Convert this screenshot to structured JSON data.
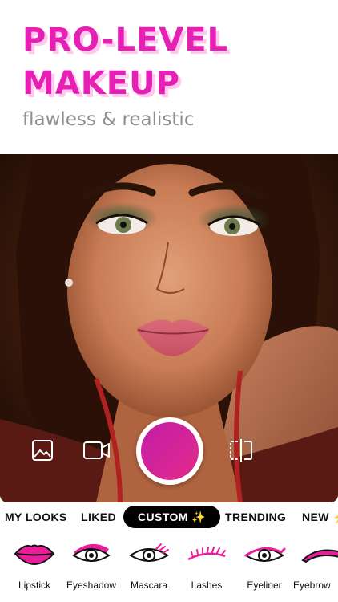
{
  "header": {
    "headline_line1": "PRO-LEVEL",
    "headline_line2": "MAKEUP",
    "tagline": "flawless & realistic"
  },
  "camera": {
    "gallery_icon": "image-icon",
    "video_icon": "video-camera-icon",
    "compare_icon": "split-compare-icon",
    "shutter_color": "#d4239c"
  },
  "tabs": [
    {
      "label": "MY LOOKS"
    },
    {
      "label": "LIKED"
    },
    {
      "label": "CUSTOM ✨"
    },
    {
      "label": "TRENDING"
    },
    {
      "label": "NEW ⚡"
    }
  ],
  "active_tab": "CUSTOM ✨",
  "tools": [
    {
      "label": "Lipstick",
      "icon": "lips-icon"
    },
    {
      "label": "Eyeshadow",
      "icon": "eyeshadow-icon"
    },
    {
      "label": "Mascara",
      "icon": "mascara-eye-icon"
    },
    {
      "label": "Lashes",
      "icon": "lashes-icon"
    },
    {
      "label": "Eyeliner",
      "icon": "eyeliner-icon"
    },
    {
      "label": "Eyebrow",
      "icon": "eyebrow-icon"
    }
  ],
  "colors": {
    "accent": "#e620b4",
    "accent_shadow": "#ffc8ec",
    "tagline": "#8f8f8f"
  }
}
